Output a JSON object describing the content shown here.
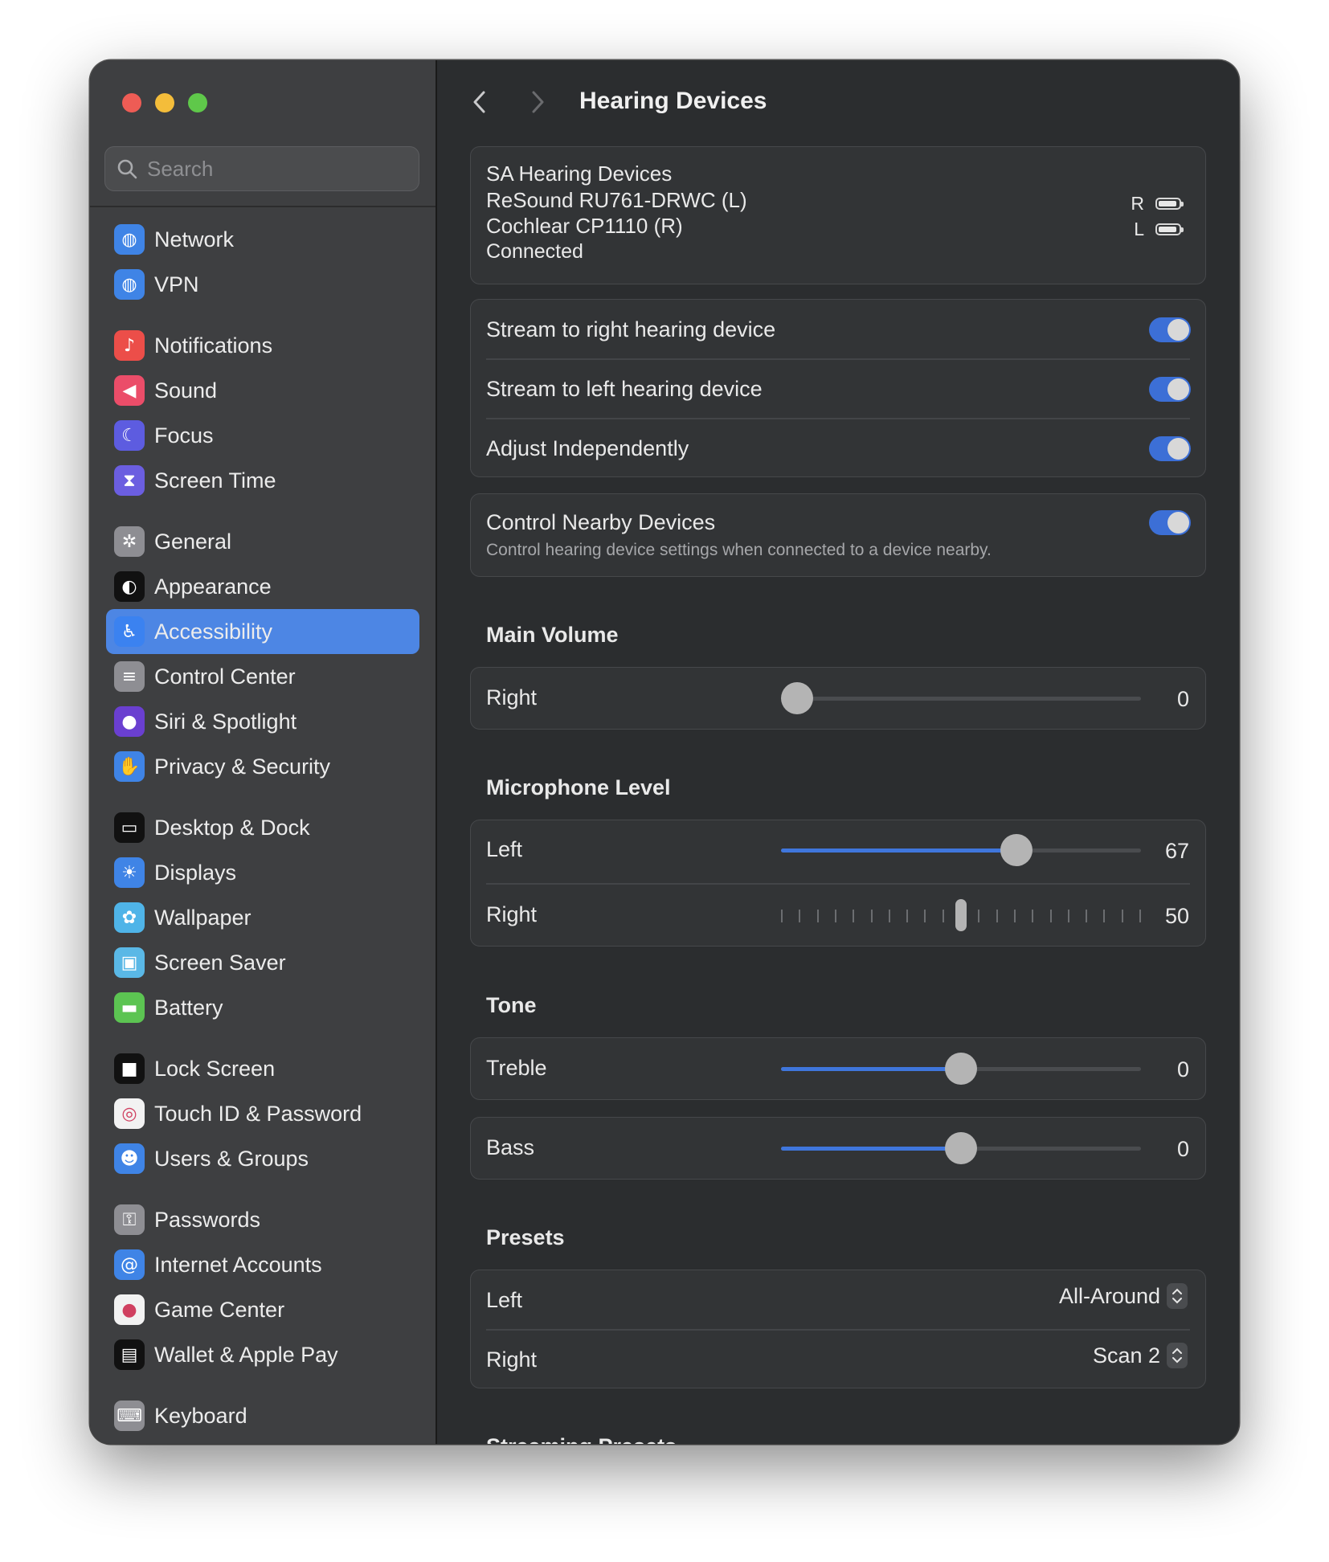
{
  "window": {
    "traffic_lights": [
      "close",
      "minimize",
      "zoom"
    ]
  },
  "sidebar": {
    "search_placeholder": "Search",
    "items": [
      {
        "label": "Network",
        "icon": "globe-icon",
        "color": "#3f84e6"
      },
      {
        "label": "VPN",
        "icon": "vpn-globe-icon",
        "color": "#3f84e6"
      },
      {
        "label": "Notifications",
        "icon": "bell-icon",
        "color": "#ec4e49"
      },
      {
        "label": "Sound",
        "icon": "speaker-icon",
        "color": "#eb4d69"
      },
      {
        "label": "Focus",
        "icon": "moon-icon",
        "color": "#5d5ce0"
      },
      {
        "label": "Screen Time",
        "icon": "hourglass-icon",
        "color": "#6b5ee0"
      },
      {
        "label": "General",
        "icon": "gear-icon",
        "color": "#8e8e93"
      },
      {
        "label": "Appearance",
        "icon": "appearance-icon",
        "color": "#111111"
      },
      {
        "label": "Accessibility",
        "icon": "accessibility-icon",
        "color": "#3b82f0"
      },
      {
        "label": "Control Center",
        "icon": "toggles-icon",
        "color": "#8e8e93"
      },
      {
        "label": "Siri & Spotlight",
        "icon": "siri-icon",
        "color": "#6a3fd0"
      },
      {
        "label": "Privacy & Security",
        "icon": "hand-icon",
        "color": "#3f84e6"
      },
      {
        "label": "Desktop & Dock",
        "icon": "dock-icon",
        "color": "#111111"
      },
      {
        "label": "Displays",
        "icon": "sun-icon",
        "color": "#3f84e6"
      },
      {
        "label": "Wallpaper",
        "icon": "flower-icon",
        "color": "#4fb4e8"
      },
      {
        "label": "Screen Saver",
        "icon": "screensaver-icon",
        "color": "#5ab8e6"
      },
      {
        "label": "Battery",
        "icon": "battery-icon",
        "color": "#5cc452"
      },
      {
        "label": "Lock Screen",
        "icon": "lock-icon",
        "color": "#111111"
      },
      {
        "label": "Touch ID & Password",
        "icon": "fingerprint-icon",
        "color": "#f2f2f2"
      },
      {
        "label": "Users & Groups",
        "icon": "users-icon",
        "color": "#3f84e6"
      },
      {
        "label": "Passwords",
        "icon": "key-icon",
        "color": "#8e8e93"
      },
      {
        "label": "Internet Accounts",
        "icon": "at-icon",
        "color": "#3f84e6"
      },
      {
        "label": "Game Center",
        "icon": "game-center-icon",
        "color": "#f2f2f2"
      },
      {
        "label": "Wallet & Apple Pay",
        "icon": "wallet-icon",
        "color": "#111111"
      },
      {
        "label": "Keyboard",
        "icon": "keyboard-icon",
        "color": "#8e8e93"
      }
    ],
    "active_index": 8
  },
  "main": {
    "title": "Hearing Devices",
    "device": {
      "name": "SA Hearing Devices",
      "left_device": "ReSound RU761-DRWC (L)",
      "right_device": "Cochlear CP1110 (R)",
      "status": "Connected",
      "battery_right_label": "R",
      "battery_left_label": "L"
    },
    "stream_toggles": [
      {
        "label": "Stream to right hearing device",
        "on": true
      },
      {
        "label": "Stream to left hearing device",
        "on": true
      },
      {
        "label": "Adjust Independently",
        "on": true
      }
    ],
    "nearby": {
      "label": "Control Nearby Devices",
      "description": "Control hearing device settings when connected to a device nearby.",
      "on": true
    },
    "main_volume": {
      "title": "Main Volume",
      "rows": [
        {
          "label": "Right",
          "value": "0",
          "fraction": 0.0
        }
      ]
    },
    "microphone": {
      "title": "Microphone Level",
      "rows": [
        {
          "label": "Left",
          "value": "67",
          "fraction": 0.67
        },
        {
          "label": "Right",
          "value": "50",
          "fraction": 0.5
        }
      ]
    },
    "tone": {
      "title": "Tone",
      "treble": {
        "label": "Treble",
        "value": "0",
        "fraction": 0.5
      },
      "bass": {
        "label": "Bass",
        "value": "0",
        "fraction": 0.5
      }
    },
    "presets": {
      "title": "Presets",
      "rows": [
        {
          "label": "Left",
          "value": "All-Around"
        },
        {
          "label": "Right",
          "value": "Scan 2"
        }
      ]
    },
    "streaming_presets_title": "Streaming Presets"
  },
  "colors": {
    "accent": "#3f76dc",
    "toggle_on": "#3c6fd6",
    "sidebar_active": "#4d86e4"
  }
}
